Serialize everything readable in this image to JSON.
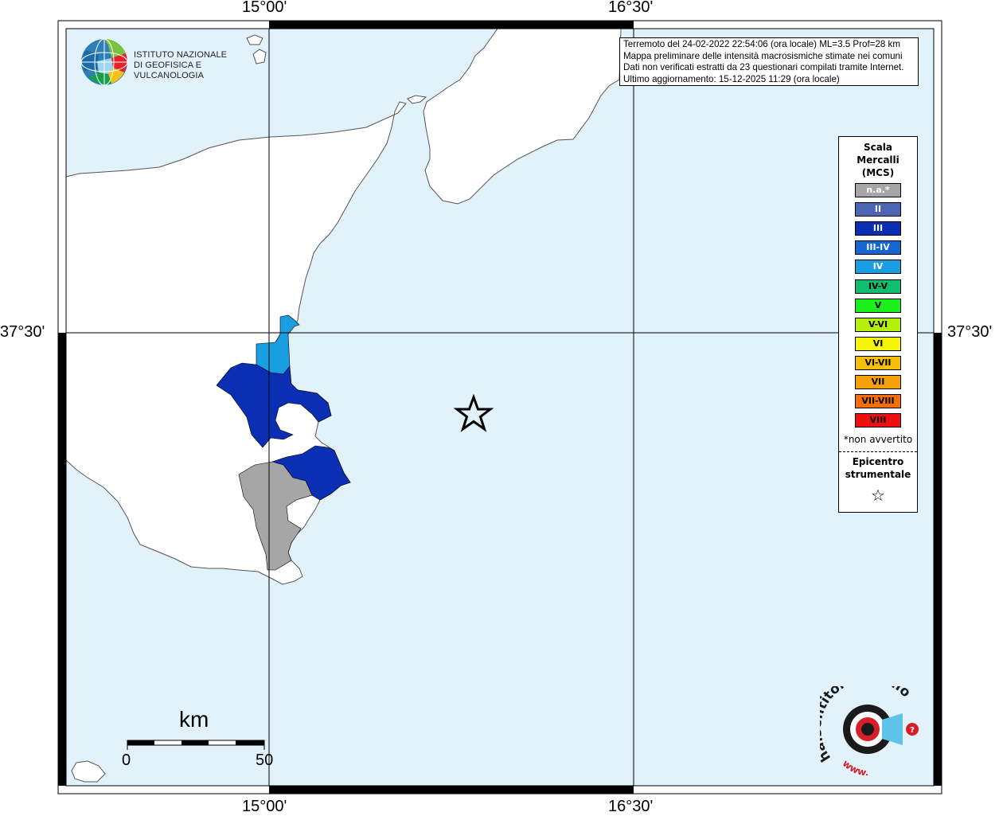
{
  "map": {
    "top_labels": [
      "15°00'",
      "16°30'"
    ],
    "bottom_labels": [
      "15°00'",
      "16°30'"
    ],
    "left_label": "37°30'",
    "right_label": "37°30'",
    "colors": {
      "sea": "#e1f2fb",
      "land": "#ffffff",
      "coast": "#555555",
      "grid": "#000000"
    }
  },
  "organization": {
    "line1": "ISTITUTO NAZIONALE",
    "line2": "DI GEOFISICA E VULCANOLOGIA"
  },
  "info": {
    "line1": "Terremoto del 24-02-2022 22:54:06 (ora locale) ML=3.5 Prof=28 km",
    "line2": "Mappa preliminare delle intensità macrosismiche stimate nei comuni",
    "line3": "Dati non verificati estratti da 23 questionari compilati tramite Internet.",
    "line4": "Ultimo aggiornamento: 15-12-2025 11:29 (ora locale)"
  },
  "legend": {
    "title_line1": "Scala",
    "title_line2": "Mercalli",
    "title_line3": "(MCS)",
    "items": [
      {
        "label": "n.a.*",
        "color": "#a6a6a6",
        "text_color": "#ffffff"
      },
      {
        "label": "II",
        "color": "#4a66b5",
        "text_color": "#ffffff"
      },
      {
        "label": "III",
        "color": "#0a2fb4",
        "text_color": "#ffffff"
      },
      {
        "label": "III-IV",
        "color": "#1466d2",
        "text_color": "#ffffff"
      },
      {
        "label": "IV",
        "color": "#1a9ee2",
        "text_color": "#ffffff"
      },
      {
        "label": "IV-V",
        "color": "#0fbe6e",
        "text_color": "#000000"
      },
      {
        "label": "V",
        "color": "#1af01a",
        "text_color": "#000000"
      },
      {
        "label": "V-VI",
        "color": "#b4f00a",
        "text_color": "#000000"
      },
      {
        "label": "VI",
        "color": "#f5f50a",
        "text_color": "#000000"
      },
      {
        "label": "VI-VII",
        "color": "#f5be0a",
        "text_color": "#000000"
      },
      {
        "label": "VII",
        "color": "#f5a00a",
        "text_color": "#000000"
      },
      {
        "label": "VII-VIII",
        "color": "#f56e0a",
        "text_color": "#000000"
      },
      {
        "label": "VIII",
        "color": "#f00f0f",
        "text_color": "#000000"
      }
    ],
    "note": "*non avvertito",
    "epicenter_line1": "Epicentro",
    "epicenter_line2": "strumentale",
    "star": "☆"
  },
  "scale_bar": {
    "unit": "km",
    "min_label": "0",
    "max_label": "50"
  },
  "site_logo": {
    "text": "haisentitoilterremoto.it",
    "prefix": "www."
  }
}
